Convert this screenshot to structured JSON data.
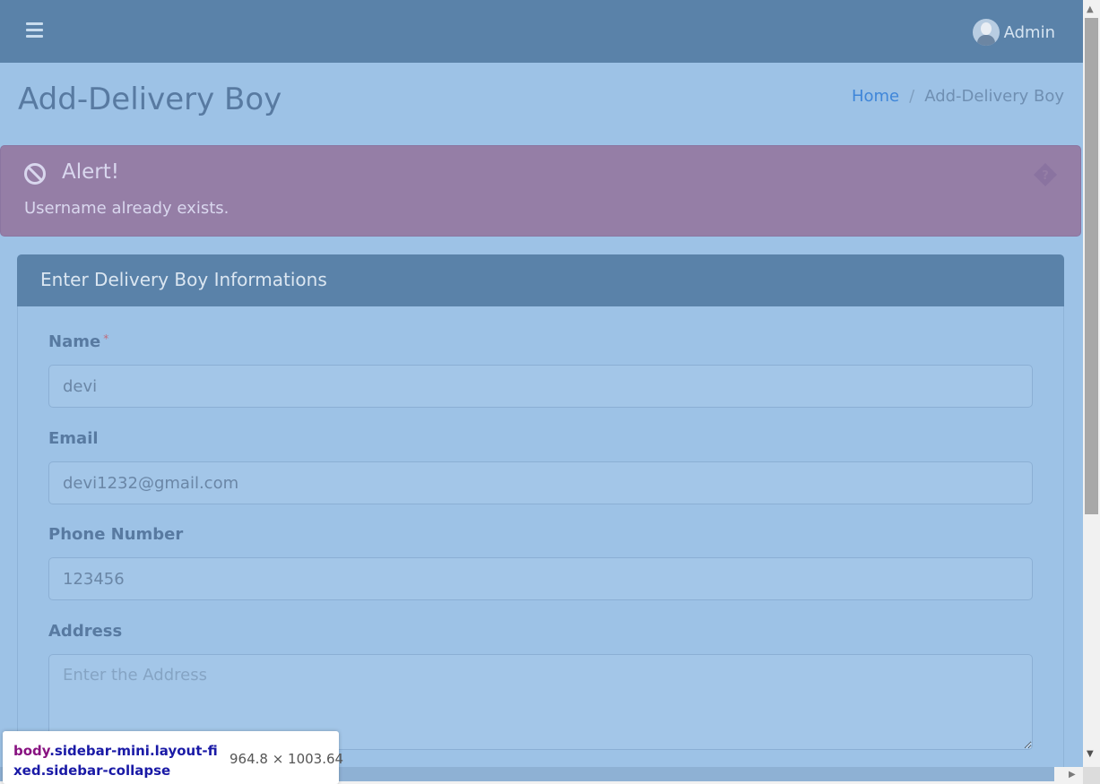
{
  "navbar": {
    "menu_icon": "hamburger-menu-icon",
    "user_icon": "user-avatar",
    "user_name": "Admin"
  },
  "page": {
    "title": "Add-Delivery Boy",
    "breadcrumb": {
      "home": "Home",
      "separator": "/",
      "current": "Add-Delivery Boy"
    }
  },
  "alert": {
    "icon": "ban-icon",
    "title": "Alert!",
    "message": "Username already exists.",
    "close_icon": "diamond-question-icon"
  },
  "form": {
    "header": "Enter Delivery Boy Informations",
    "name": {
      "label": "Name",
      "required_mark": "*",
      "value": "devi"
    },
    "email": {
      "label": "Email",
      "value": "devi1232@gmail.com"
    },
    "phone": {
      "label": "Phone Number",
      "value": "123456"
    },
    "address": {
      "label": "Address",
      "placeholder": "Enter the Address",
      "value": ""
    }
  },
  "inspector": {
    "selector_tag": "body",
    "selector_classes": ".sidebar-mini.layout-fixed.sidebar-collapse",
    "size": "964.8 × 1003.64"
  },
  "colors": {
    "navbar": "#5a82a9",
    "background": "#9dc2e6",
    "alert": "#957ea6",
    "link": "#3f86d9"
  }
}
